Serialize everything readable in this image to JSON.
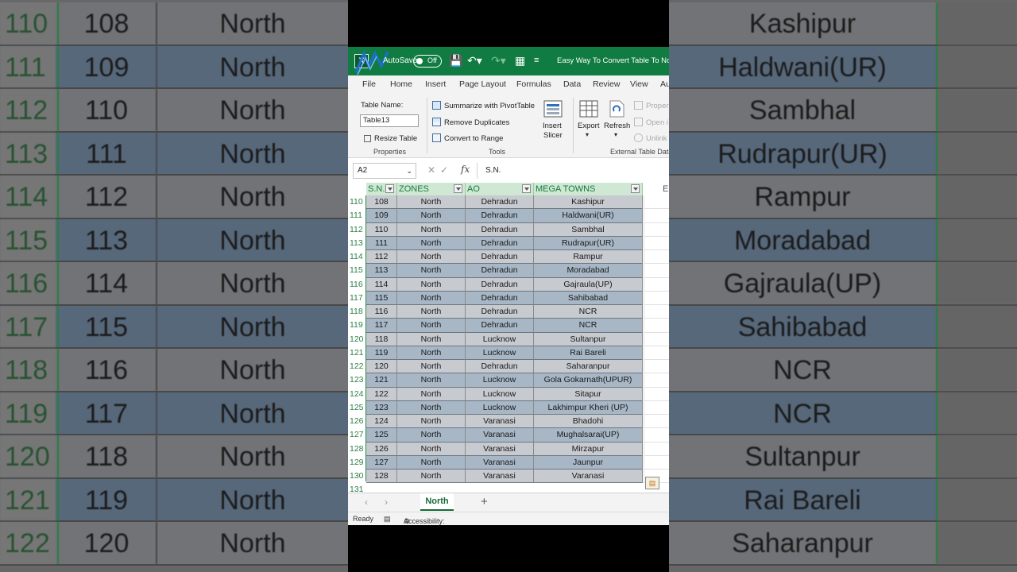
{
  "app": {
    "autosave_label": "AutoSave",
    "autosave_state": "Off",
    "doc_title": "Easy Way To Convert Table To Norm",
    "accent": "#107c41"
  },
  "tabs": [
    "File",
    "Home",
    "Insert",
    "Page Layout",
    "Formulas",
    "Data",
    "Review",
    "View",
    "Au"
  ],
  "ribbon": {
    "table_name_label": "Table Name:",
    "table_name_value": "Table13",
    "resize_table": "Resize Table",
    "properties_group": "Properties",
    "summarize": "Summarize with PivotTable",
    "remove_duplicates": "Remove Duplicates",
    "convert_to_range": "Convert to Range",
    "tools_group": "Tools",
    "insert_slicer_1": "Insert",
    "insert_slicer_2": "Slicer",
    "export": "Export",
    "refresh": "Refresh",
    "properties_btn": "Proper",
    "open_btn": "Open i",
    "unlink_btn": "Unlink",
    "external_group": "External Table Data"
  },
  "formula_bar": {
    "name_box": "A2",
    "formula": "S.N."
  },
  "sheet": {
    "headers": [
      "S.N.",
      "ZONES",
      "AO",
      "MEGA TOWNS"
    ],
    "col_e": "E",
    "rows": [
      {
        "row": "110",
        "sn": "108",
        "zone": "North",
        "ao": "Dehradun",
        "town": "Kashipur"
      },
      {
        "row": "111",
        "sn": "109",
        "zone": "North",
        "ao": "Dehradun",
        "town": "Haldwani(UR)"
      },
      {
        "row": "112",
        "sn": "110",
        "zone": "North",
        "ao": "Dehradun",
        "town": "Sambhal"
      },
      {
        "row": "113",
        "sn": "111",
        "zone": "North",
        "ao": "Dehradun",
        "town": "Rudrapur(UR)"
      },
      {
        "row": "114",
        "sn": "112",
        "zone": "North",
        "ao": "Dehradun",
        "town": "Rampur"
      },
      {
        "row": "115",
        "sn": "113",
        "zone": "North",
        "ao": "Dehradun",
        "town": "Moradabad"
      },
      {
        "row": "116",
        "sn": "114",
        "zone": "North",
        "ao": "Dehradun",
        "town": "Gajraula(UP)"
      },
      {
        "row": "117",
        "sn": "115",
        "zone": "North",
        "ao": "Dehradun",
        "town": "Sahibabad"
      },
      {
        "row": "118",
        "sn": "116",
        "zone": "North",
        "ao": "Dehradun",
        "town": "NCR"
      },
      {
        "row": "119",
        "sn": "117",
        "zone": "North",
        "ao": "Dehradun",
        "town": "NCR"
      },
      {
        "row": "120",
        "sn": "118",
        "zone": "North",
        "ao": "Lucknow",
        "town": "Sultanpur"
      },
      {
        "row": "121",
        "sn": "119",
        "zone": "North",
        "ao": "Lucknow",
        "town": "Rai Bareli"
      },
      {
        "row": "122",
        "sn": "120",
        "zone": "North",
        "ao": "Dehradun",
        "town": "Saharanpur"
      },
      {
        "row": "123",
        "sn": "121",
        "zone": "North",
        "ao": "Lucknow",
        "town": "Gola Gokarnath(UPUR)"
      },
      {
        "row": "124",
        "sn": "122",
        "zone": "North",
        "ao": "Lucknow",
        "town": "Sitapur"
      },
      {
        "row": "125",
        "sn": "123",
        "zone": "North",
        "ao": "Lucknow",
        "town": "Lakhimpur Kheri (UP)"
      },
      {
        "row": "126",
        "sn": "124",
        "zone": "North",
        "ao": "Varanasi",
        "town": "Bhadohi"
      },
      {
        "row": "127",
        "sn": "125",
        "zone": "North",
        "ao": "Varanasi",
        "town": "Mughalsarai(UP)"
      },
      {
        "row": "128",
        "sn": "126",
        "zone": "North",
        "ao": "Varanasi",
        "town": "Mirzapur"
      },
      {
        "row": "129",
        "sn": "127",
        "zone": "North",
        "ao": "Varanasi",
        "town": "Jaunpur"
      },
      {
        "row": "130",
        "sn": "128",
        "zone": "North",
        "ao": "Varanasi",
        "town": "Varanasi"
      }
    ],
    "next_row": "131"
  },
  "sheet_tabs": {
    "active": "North",
    "add": "+"
  },
  "status": {
    "ready": "Ready",
    "accessibility": "Accessibility: Investigate"
  },
  "background_left": [
    {
      "row": "110",
      "sn": "108",
      "zone": "North"
    },
    {
      "row": "111",
      "sn": "109",
      "zone": "North"
    },
    {
      "row": "112",
      "sn": "110",
      "zone": "North"
    },
    {
      "row": "113",
      "sn": "111",
      "zone": "North"
    },
    {
      "row": "114",
      "sn": "112",
      "zone": "North"
    },
    {
      "row": "115",
      "sn": "113",
      "zone": "North"
    },
    {
      "row": "116",
      "sn": "114",
      "zone": "North"
    },
    {
      "row": "117",
      "sn": "115",
      "zone": "North"
    },
    {
      "row": "118",
      "sn": "116",
      "zone": "North"
    },
    {
      "row": "119",
      "sn": "117",
      "zone": "North"
    },
    {
      "row": "120",
      "sn": "118",
      "zone": "North"
    },
    {
      "row": "121",
      "sn": "119",
      "zone": "North"
    },
    {
      "row": "122",
      "sn": "120",
      "zone": "North"
    }
  ],
  "background_right": [
    "Kashipur",
    "Haldwani(UR)",
    "Sambhal",
    "Rudrapur(UR)",
    "Rampur",
    "Moradabad",
    "Gajraula(UP)",
    "Sahibabad",
    "NCR",
    "NCR",
    "Sultanpur",
    "Rai Bareli",
    "Saharanpur"
  ]
}
